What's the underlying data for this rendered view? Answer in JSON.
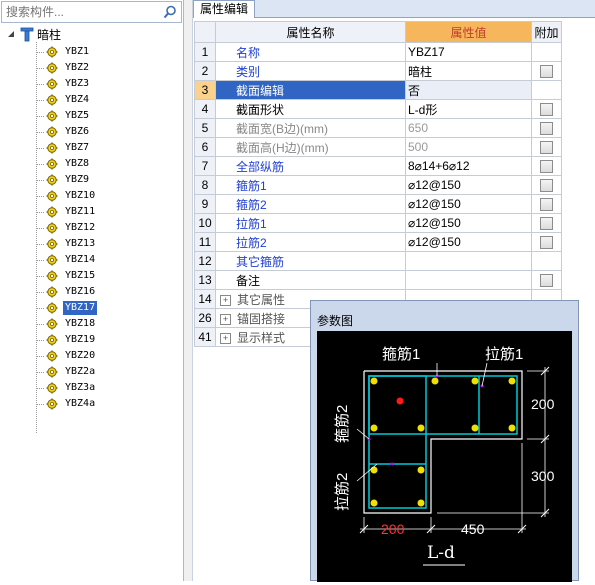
{
  "search": {
    "placeholder": "搜索构件..."
  },
  "tree": {
    "root_label": "暗柱",
    "items": [
      "YBZ1",
      "YBZ2",
      "YBZ3",
      "YBZ4",
      "YBZ5",
      "YBZ6",
      "YBZ7",
      "YBZ8",
      "YBZ9",
      "YBZ10",
      "YBZ11",
      "YBZ12",
      "YBZ13",
      "YBZ14",
      "YBZ15",
      "YBZ16",
      "YBZ17",
      "YBZ18",
      "YBZ19",
      "YBZ20",
      "YBZ2a",
      "YBZ3a",
      "YBZ4a"
    ],
    "selected": "YBZ17"
  },
  "panel": {
    "tab_label": "属性编辑",
    "headers": {
      "name": "属性名称",
      "value": "属性值",
      "extra": "附加"
    },
    "rows": [
      {
        "num": "1",
        "name": "名称",
        "value": "YBZ17",
        "checkbox": false
      },
      {
        "num": "2",
        "name": "类别",
        "value": "暗柱",
        "checkbox": true
      },
      {
        "num": "3",
        "name": "截面编辑",
        "value": "否",
        "checkbox": false
      },
      {
        "num": "4",
        "name": "截面形状",
        "value": "L-d形",
        "checkbox": true
      },
      {
        "num": "5",
        "name": "截面宽(B边)(mm)",
        "value": "650",
        "checkbox": true
      },
      {
        "num": "6",
        "name": "截面高(H边)(mm)",
        "value": "500",
        "checkbox": true
      },
      {
        "num": "7",
        "name": "全部纵筋",
        "value": "8⌀14+6⌀12",
        "checkbox": true
      },
      {
        "num": "8",
        "name": "箍筋1",
        "value": "⌀12@150",
        "checkbox": true
      },
      {
        "num": "9",
        "name": "箍筋2",
        "value": "⌀12@150",
        "checkbox": true
      },
      {
        "num": "10",
        "name": "拉筋1",
        "value": "⌀12@150",
        "checkbox": true
      },
      {
        "num": "11",
        "name": "拉筋2",
        "value": "⌀12@150",
        "checkbox": true
      },
      {
        "num": "12",
        "name": "其它箍筋",
        "value": "",
        "checkbox": false
      },
      {
        "num": "13",
        "name": "备注",
        "value": "",
        "checkbox": true
      },
      {
        "num": "14",
        "name": "其它属性",
        "value": "",
        "checkbox": false
      },
      {
        "num": "26",
        "name": "锚固搭接",
        "value": "",
        "checkbox": false
      },
      {
        "num": "41",
        "name": "显示样式",
        "value": "",
        "checkbox": false
      }
    ]
  },
  "dialog": {
    "title": "参数图",
    "labels": {
      "stirrup1": "箍筋1",
      "tie1": "拉筋1",
      "stirrup2": "箍筋2",
      "tie2": "拉筋2",
      "dim_200_right": "200",
      "dim_300_right": "300",
      "dim_200_bottom": "200",
      "dim_450_bottom": "450",
      "shape": "L-d"
    }
  },
  "colors": {
    "selection": "#3165c4",
    "value_header": "#f6b75c",
    "blue_text": "#1f3fd0",
    "rebar": "#00c8d8",
    "bar_dot": "#f0e000"
  }
}
